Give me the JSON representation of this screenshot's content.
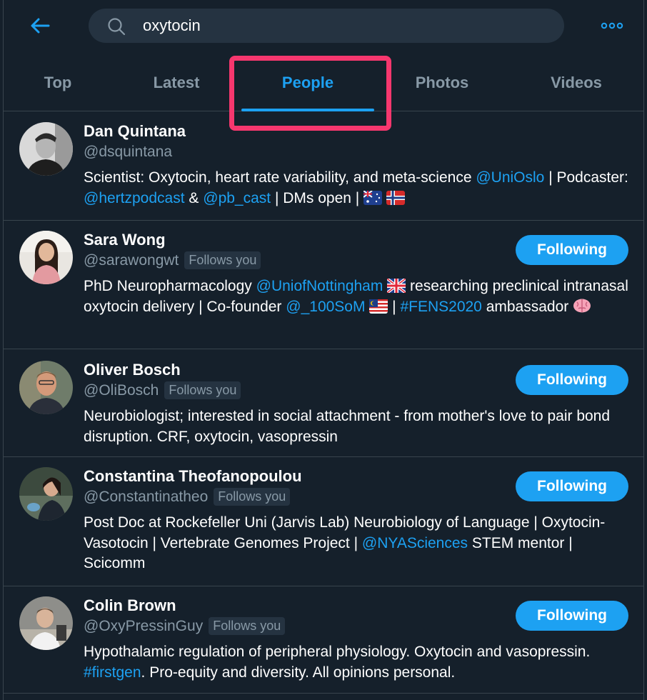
{
  "search": {
    "query": "oxytocin"
  },
  "tabs": [
    {
      "label": "Top"
    },
    {
      "label": "Latest"
    },
    {
      "label": "People",
      "active": true
    },
    {
      "label": "Photos"
    },
    {
      "label": "Videos"
    }
  ],
  "colors": {
    "background": "#15202b",
    "accent": "#1da1f2",
    "muted_text": "#8899a6",
    "highlight": "#f6376e",
    "divider": "#38444d"
  },
  "icons": {
    "back": "arrow-left-icon",
    "search": "search-icon",
    "more": "more-dots-icon"
  },
  "people": [
    {
      "name": "Dan Quintana",
      "handle": "@dsquintana",
      "follows_you": null,
      "following_label": null,
      "bio": {
        "t1": "Scientist: Oxytocin, heart rate variability, and meta-science ",
        "l1": "@UniOslo",
        "t2": " | Podcaster: ",
        "l2": "@hertzpodcast",
        "t3": " & ",
        "l3": "@pb_cast",
        "t4": " | DMs open | ",
        "emoji": [
          "flag-australia",
          "flag-norway"
        ]
      }
    },
    {
      "name": "Sara Wong",
      "handle": "@sarawongwt",
      "follows_you": "Follows you",
      "following_label": "Following",
      "bio": {
        "t1": "PhD Neuropharmacology ",
        "l1": "@UniofNottingham",
        "t2": " researching preclinical intranasal oxytocin delivery | Co-founder ",
        "l2": "@_100SoM",
        "t3": " | ",
        "l3": "#FENS2020",
        "t4": " ambassador ",
        "emoji": [
          "flag-uk",
          "flag-malaysia",
          "brain-emoji"
        ]
      }
    },
    {
      "name": "Oliver Bosch",
      "handle": "@OliBosch",
      "follows_you": "Follows you",
      "following_label": "Following",
      "bio": {
        "t1": "Neurobiologist; interested in social attachment - from mother's love to pair bond disruption. CRF, oxytocin, vasopressin"
      }
    },
    {
      "name": "Constantina Theofanopoulou",
      "handle": "@Constantinatheo",
      "follows_you": "Follows you",
      "following_label": "Following",
      "bio": {
        "t1": "Post Doc at Rockefeller Uni (Jarvis Lab) Neurobiology of Language | Oxytocin-Vasotocin | Vertebrate Genomes Project | ",
        "l1": "@NYASciences",
        "t2": " STEM mentor | Scicomm"
      }
    },
    {
      "name": "Colin Brown",
      "handle": "@OxyPressinGuy",
      "follows_you": "Follows you",
      "following_label": "Following",
      "bio": {
        "t1": "Hypothalamic regulation of peripheral physiology. Oxytocin and vasopressin. ",
        "l1": "#firstgen",
        "t2": ". Pro-equity and diversity. All opinions personal."
      }
    }
  ]
}
